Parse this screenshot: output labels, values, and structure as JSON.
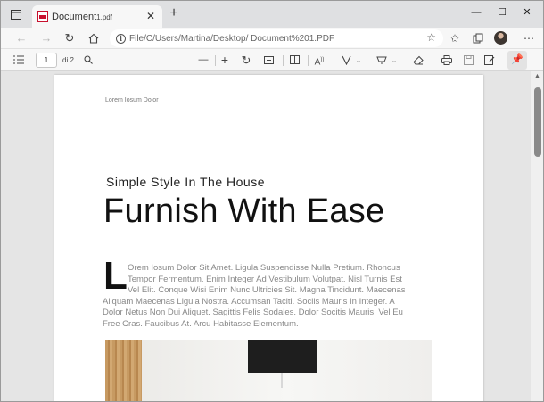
{
  "tab": {
    "title_main": "Document",
    "title_sub": "1.pdf",
    "close_glyph": "✕",
    "new_tab_glyph": "+"
  },
  "window_controls": {
    "minimize": "—",
    "maximize": "☐",
    "close": "✕"
  },
  "address_bar": {
    "url": "File/C/Users/Martina/Desktop/ Document%201.PDF"
  },
  "pdf_toolbar": {
    "page_current": "1",
    "page_total": "di 2"
  },
  "document": {
    "header_small": "Lorem Iosum Dolor",
    "subtitle": "Simple Style In The House",
    "title": "Furnish With Ease",
    "dropcap": "L",
    "body_lines": [
      "Orem Iosum Dolor Sit Amet. Ligula Suspendisse Nulla Pretium. Rhoncus",
      "Tempor Fermentum. Enim Integer Ad Vestibulum Volutpat. Nisl Turnis Est",
      "Vel Elit. Conque Wisi Enim Nunc Ultricies Sit. Magna Tincidunt. Maecenas",
      "Aliquam Maecenas Ligula Nostra. Accumsan Taciti. Socils Mauris In Integer. A",
      "Dolor Netus Non Dui Aliquet. Sagittis Felis Sodales. Dolor Socitis Mauris. Vel Eu",
      "Free Cras. Faucibus At. Arcu Habitasse Elementum."
    ]
  },
  "colors": {
    "page_bg": "#ffffff",
    "chrome_bg": "#f7f7f7",
    "pdf_red": "#c8102e"
  }
}
